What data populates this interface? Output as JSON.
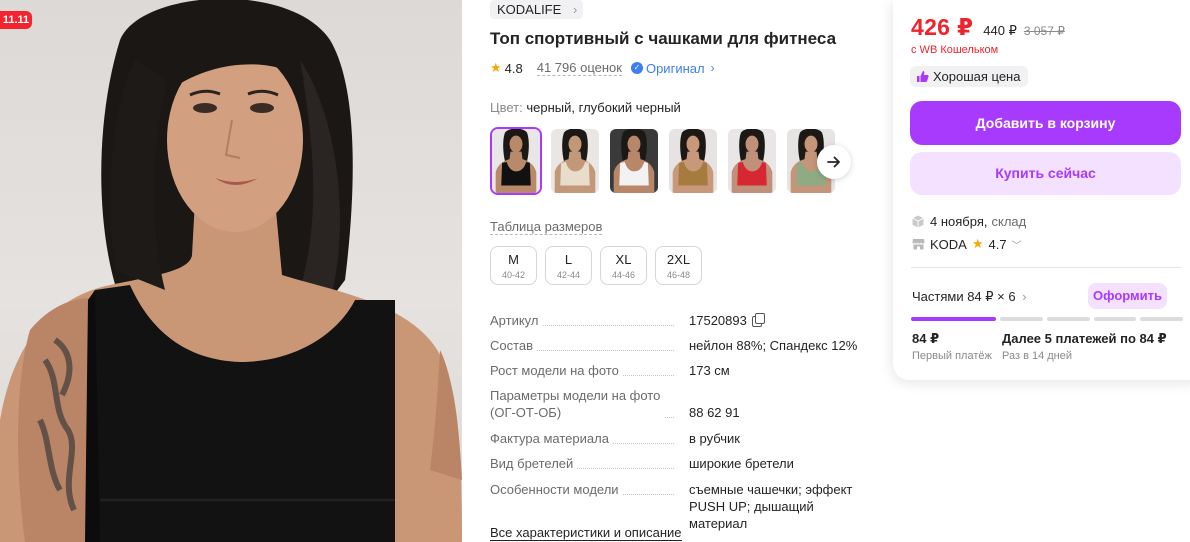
{
  "photo": {
    "promo_badge": "11.11"
  },
  "product": {
    "brand": "KODALIFE",
    "title": "Топ спортивный с чашками для фитнеса",
    "rating": "4.8",
    "reviews": "41 796 оценок",
    "original_label": "Оригинал"
  },
  "color": {
    "label": "Цвет:",
    "value": "черный, глубокий черный",
    "swatches": [
      {
        "name": "black",
        "top": "#111111",
        "skin": "#b98a6a",
        "bg": "#e8e6e6",
        "active": true
      },
      {
        "name": "beige",
        "top": "#e8dccb",
        "skin": "#c39878",
        "bg": "#e9e6e4",
        "active": false
      },
      {
        "name": "white",
        "top": "#f2f2f2",
        "skin": "#b8876a",
        "bg": "#3a3a3a",
        "active": false
      },
      {
        "name": "brown",
        "top": "#a77a3e",
        "skin": "#c8987a",
        "bg": "#e6e3e2",
        "active": false
      },
      {
        "name": "red",
        "top": "#d72732",
        "skin": "#c0907a",
        "bg": "#e8e6e6",
        "active": false
      },
      {
        "name": "green",
        "top": "#8fab84",
        "skin": "#c49578",
        "bg": "#e6e4e3",
        "active": false
      }
    ]
  },
  "sizes": {
    "table_link": "Таблица размеров",
    "items": [
      {
        "size": "M",
        "range": "40-42"
      },
      {
        "size": "L",
        "range": "42-44"
      },
      {
        "size": "XL",
        "range": "44-46"
      },
      {
        "size": "2XL",
        "range": "46-48"
      }
    ]
  },
  "specs": [
    {
      "key": "Артикул",
      "value": "17520893",
      "copy": true
    },
    {
      "key": "Состав",
      "value": "нейлон 88%; Спандекс 12%"
    },
    {
      "key": "Рост модели на фото",
      "value": "173 см"
    },
    {
      "key": "Параметры модели на фото (ОГ-ОТ-ОБ)",
      "value": "88 62 91"
    },
    {
      "key": "Фактура материала",
      "value": "в рубчик"
    },
    {
      "key": "Вид бретелей",
      "value": "широкие бретели"
    },
    {
      "key": "Особенности модели",
      "value": "съемные чашечки; эффект PUSH UP; дышащий материал"
    }
  ],
  "all_specs_link": "Все характеристики и описание",
  "card": {
    "price": "426 ₽",
    "old_price": "440 ₽",
    "crossed_price": "3 057 ₽",
    "wallet_note": "с WB Кошельком",
    "good_price": "Хорошая цена",
    "add_to_cart": "Добавить в корзину",
    "buy_now": "Купить сейчас",
    "delivery_date": "4 ноября,",
    "delivery_place": "склад",
    "seller_name": "KODA",
    "seller_rating": "4.7",
    "installments_label": "Частями 84 ₽ × 6",
    "checkout": "Оформить",
    "installment_progress": 0.333,
    "first_payment": "84 ₽",
    "first_payment_label": "Первый платёж",
    "rest_payments": "Далее 5 платежей по 84 ₽",
    "rest_payments_label": "Раз в 14 дней"
  },
  "colors": {
    "accent": "#a73afd",
    "accent_light": "#f3e1ff",
    "price_red": "#f0232d",
    "star": "#f6a80b",
    "original_blue": "#3d7ef0"
  }
}
